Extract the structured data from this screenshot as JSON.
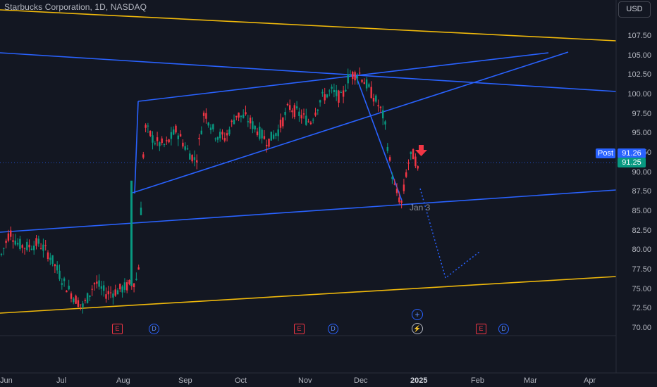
{
  "header": {
    "title": "Starbucks Corporation, 1D, NASDAQ",
    "currency_button": "USD"
  },
  "price_tags": {
    "post_label": "Post",
    "post_value": "91.26",
    "last_value": "91.25"
  },
  "annotation": {
    "date_label": "Jan 3"
  },
  "events": {
    "earnings": "E",
    "dividend": "D",
    "plus": "+",
    "flash": "⚡"
  },
  "colors": {
    "up": "#089981",
    "down": "#f23645",
    "trend_blue": "#2962ff",
    "trend_yellow": "#f0b90b",
    "background": "#131722"
  },
  "chart_data": {
    "type": "candlestick",
    "title": "Starbucks Corporation, 1D, NASDAQ",
    "y_axis": {
      "ticks": [
        "107.50",
        "105.00",
        "102.50",
        "100.00",
        "97.50",
        "95.00",
        "92.50",
        "90.00",
        "87.50",
        "85.00",
        "82.50",
        "80.00",
        "77.50",
        "75.00",
        "72.50",
        "70.00"
      ],
      "range": [
        68.5,
        110
      ]
    },
    "x_axis": {
      "ticks": [
        "Jun",
        "Jul",
        "Aug",
        "Sep",
        "Oct",
        "Nov",
        "Dec",
        "2025",
        "Feb",
        "Mar",
        "Apr"
      ]
    },
    "last_price": 91.25,
    "post_market_price": 91.26,
    "approx_closes": {
      "Jun": 79.0,
      "early Jul": 75.0,
      "mid Jul": 73.0,
      "Aug 8": 89.0,
      "Sep": 94.0,
      "Oct": 96.5,
      "Nov": 98.5,
      "late Nov": 102.0,
      "early Dec": 98.0,
      "Dec 20": 86.0,
      "Dec 27": 92.0,
      "Jan 3": 91.25
    },
    "projection_path": [
      {
        "date": "Jan 3",
        "price": 91.0
      },
      {
        "date": "late Jan",
        "price": 76.3
      },
      {
        "date": "mid Feb",
        "price": 80.0
      }
    ]
  }
}
